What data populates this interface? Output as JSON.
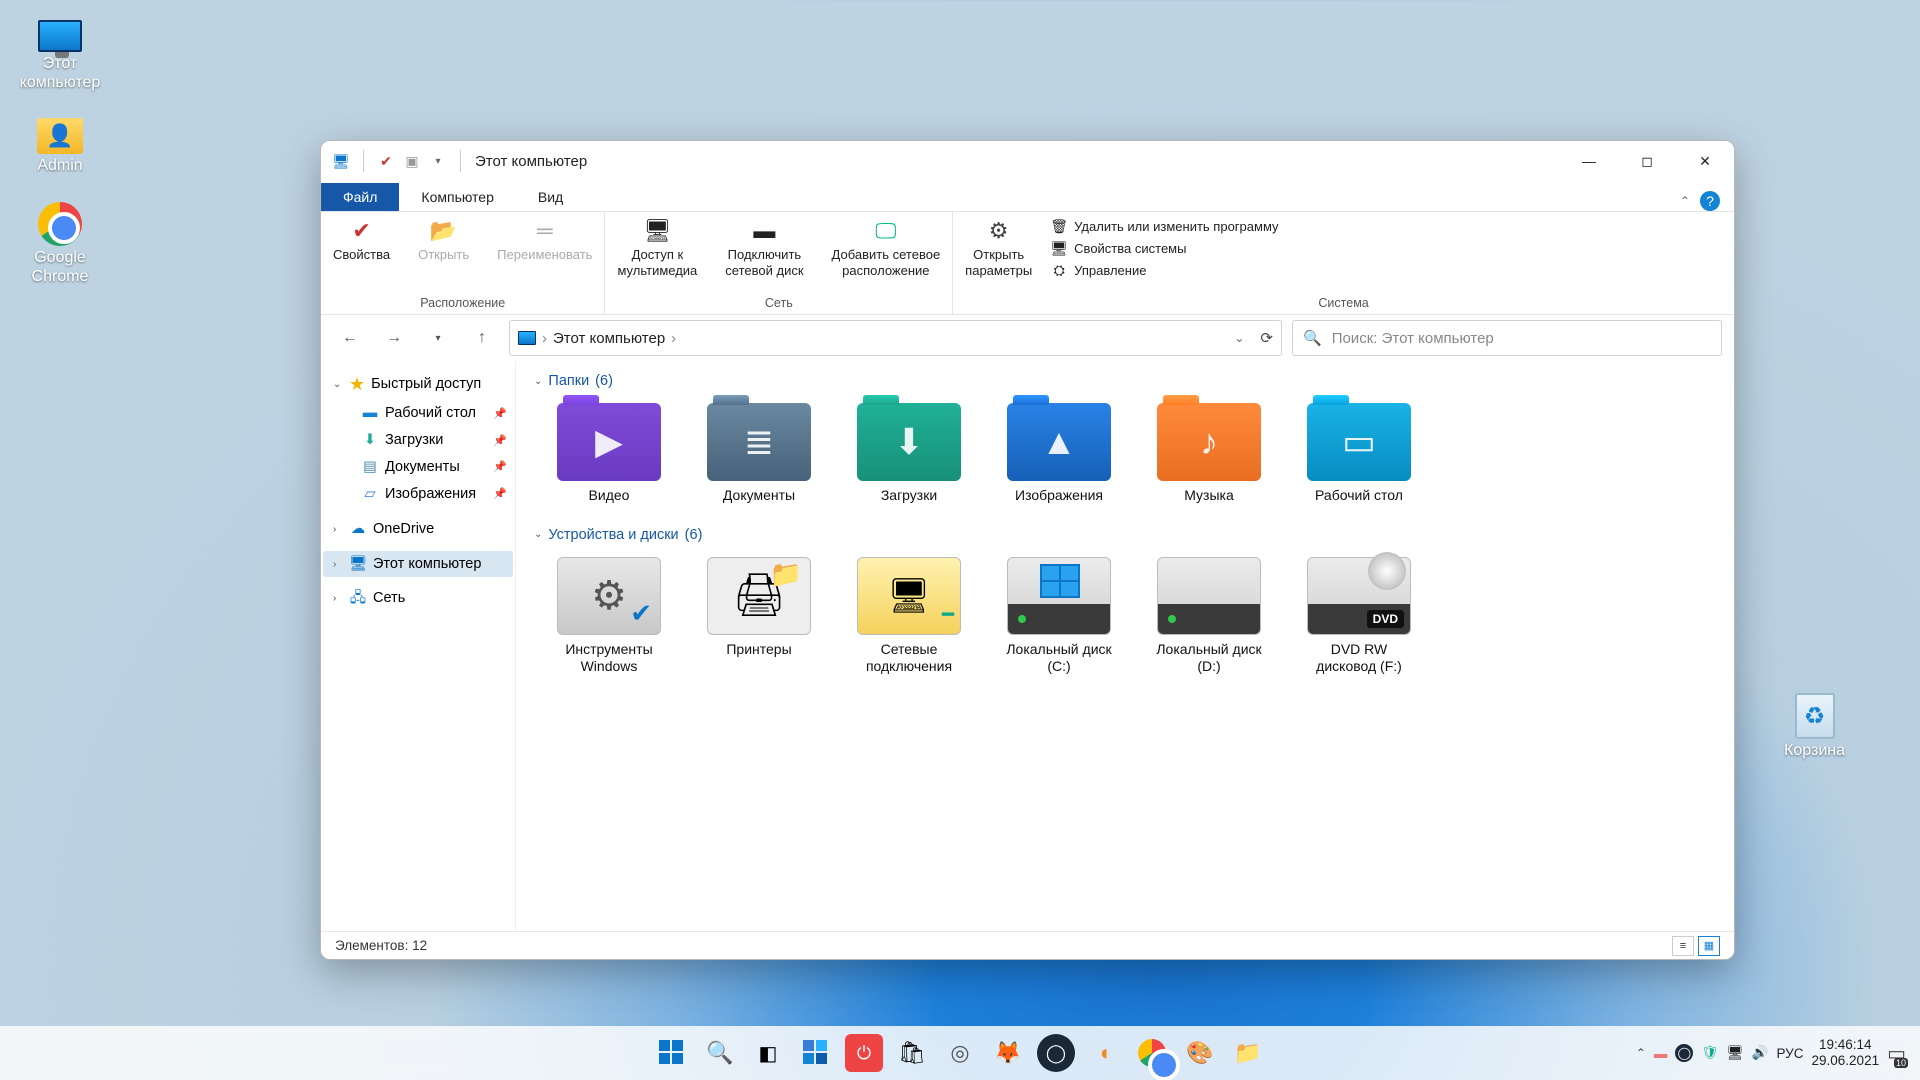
{
  "desktop": {
    "this_pc": "Этот\nкомпьютер",
    "admin": "Admin",
    "chrome": "Google\nChrome",
    "recycle": "Корзина"
  },
  "titlebar": {
    "title": "Этот компьютер"
  },
  "ribbon_tabs": {
    "file": "Файл",
    "computer": "Компьютер",
    "view": "Вид"
  },
  "ribbon": {
    "groups": {
      "location": {
        "caption": "Расположение",
        "properties": "Свойства",
        "open": "Открыть",
        "rename": "Переименовать"
      },
      "network": {
        "caption": "Сеть",
        "media": "Доступ к\nмультимедиа",
        "map": "Подключить\nсетевой диск",
        "add": "Добавить сетевое\nрасположение"
      },
      "system": {
        "caption": "Система",
        "open_settings": "Открыть\nпараметры",
        "uninstall": "Удалить или изменить программу",
        "sysprops": "Свойства системы",
        "manage": "Управление"
      }
    }
  },
  "addr": {
    "location": "Этот компьютер"
  },
  "search": {
    "placeholder": "Поиск: Этот компьютер"
  },
  "tree": {
    "quick": "Быстрый доступ",
    "desktop": "Рабочий стол",
    "downloads": "Загрузки",
    "documents": "Документы",
    "pictures": "Изображения",
    "onedrive": "OneDrive",
    "thispc": "Этот компьютер",
    "network": "Сеть"
  },
  "sections": {
    "folders_label": "Папки",
    "folders_count": "(6)",
    "devices_label": "Устройства и диски",
    "devices_count": "(6)"
  },
  "folders": {
    "video": "Видео",
    "docs": "Документы",
    "downloads": "Загрузки",
    "pictures": "Изображения",
    "music": "Музыка",
    "desktop": "Рабочий стол"
  },
  "devices": {
    "wintools": "Инструменты\nWindows",
    "printers": "Принтеры",
    "netconn": "Сетевые\nподключения",
    "diskc": "Локальный диск\n(C:)",
    "diskd": "Локальный диск\n(D:)",
    "dvd": "DVD RW\nдисковод (F:)",
    "dvd_tag": "DVD"
  },
  "status": {
    "items": "Элементов: 12"
  },
  "tray": {
    "lang": "РУС",
    "time": "19:46:14",
    "date": "29.06.2021",
    "notif_count": "10"
  }
}
